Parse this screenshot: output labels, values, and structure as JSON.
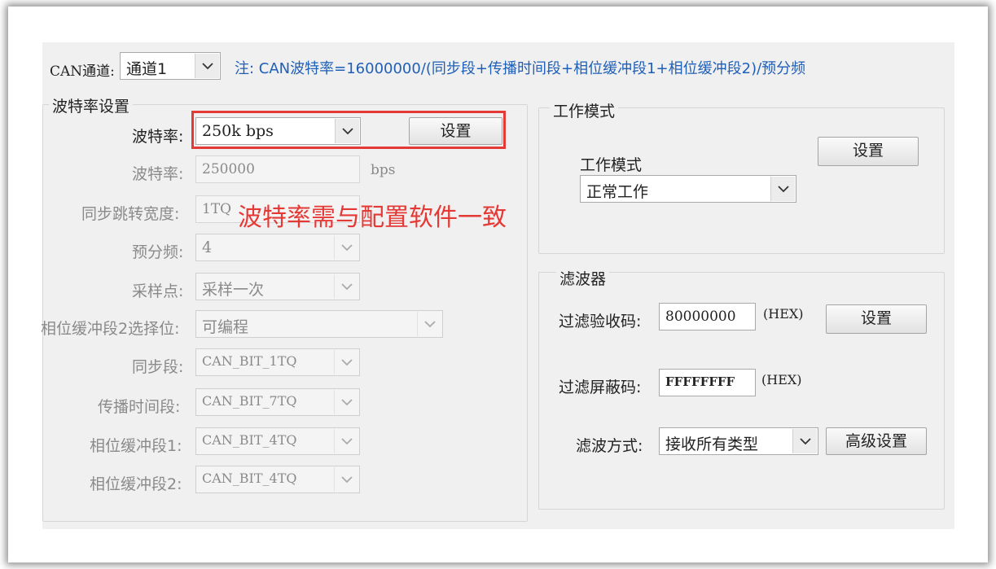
{
  "channel": {
    "label": "CAN通道:",
    "value": "通道1",
    "note": "注: CAN波特率=16000000/(同步段+传播时间段+相位缓冲段1+相位缓冲段2)/预分频"
  },
  "baud_group": {
    "title": "波特率设置",
    "baud_rate_label": "波特率:",
    "baud_rate_value": "250k bps",
    "set_button": "设置",
    "baud_numeric_label": "波特率:",
    "baud_numeric_value": "250000",
    "baud_unit": "bps",
    "sjw_label": "同步跳转宽度:",
    "sjw_value": "1TQ",
    "prescaler_label": "预分频:",
    "prescaler_value": "4",
    "sample_label": "采样点:",
    "sample_value": "采样一次",
    "phase2_select_label": "相位缓冲段2选择位:",
    "phase2_select_value": "可编程",
    "sync_seg_label": "同步段:",
    "sync_seg_value": "CAN_BIT_1TQ",
    "prop_seg_label": "传播时间段:",
    "prop_seg_value": "CAN_BIT_7TQ",
    "phase1_label": "相位缓冲段1:",
    "phase1_value": "CAN_BIT_4TQ",
    "phase2_label": "相位缓冲段2:",
    "phase2_value": "CAN_BIT_4TQ"
  },
  "annotation": {
    "text": "波特率需与配置软件一致",
    "color": "#e53935"
  },
  "work_mode": {
    "title": "工作模式",
    "mode_label": "工作模式",
    "mode_value": "正常工作",
    "set_button": "设置"
  },
  "filter": {
    "title": "滤波器",
    "accept_label": "过滤验收码:",
    "accept_value": "80000000",
    "accept_unit": "(HEX)",
    "set_button": "设置",
    "mask_label": "过滤屏蔽码:",
    "mask_value": "FFFFFFFF",
    "mask_unit": "(HEX)",
    "method_label": "滤波方式:",
    "method_value": "接收所有类型",
    "advanced_button": "高级设置"
  },
  "colors": {
    "note": "#1f5fb8",
    "highlight_box": "#e53935"
  }
}
